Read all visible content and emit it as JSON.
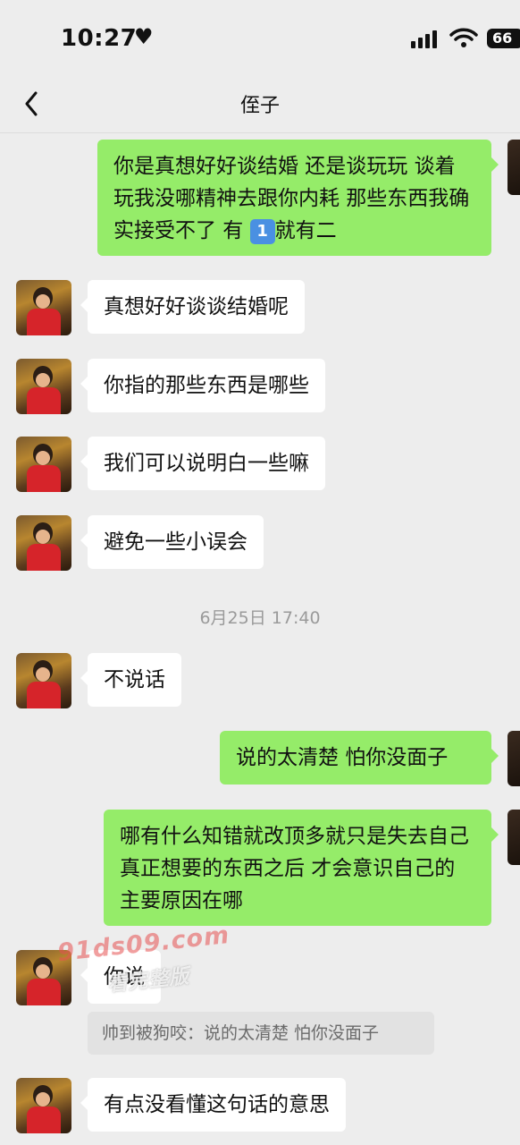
{
  "status": {
    "time": "10:27",
    "battery": "66"
  },
  "header": {
    "title": "侄子"
  },
  "messages": [
    {
      "side": "out",
      "text_a": "你是真想好好谈结婚 还是谈玩玩 谈着玩我没哪精神去跟你内耗 那些东西我确实接受不了 有",
      "emoji": "1",
      "text_b": "就有二"
    },
    {
      "side": "in",
      "text": "真想好好谈谈结婚呢"
    },
    {
      "side": "in",
      "text": "你指的那些东西是哪些"
    },
    {
      "side": "in",
      "text": "我们可以说明白一些嘛"
    },
    {
      "side": "in",
      "text": "避免一些小误会"
    },
    {
      "side": "in",
      "text": "不说话"
    },
    {
      "side": "out",
      "text": "说的太清楚 怕你没面子"
    },
    {
      "side": "out",
      "text": "哪有什么知错就改顶多就只是失去自己真正想要的东西之后 才会意识自己的主要原因在哪"
    },
    {
      "side": "in",
      "text": "你说"
    },
    {
      "side": "in",
      "text": "有点没看懂这句话的意思"
    }
  ],
  "timestamp": "6月25日 17:40",
  "quote": "帅到被狗咬：说的太清楚 怕你没面子",
  "watermark": {
    "line1": "91ds09.com",
    "line2": "看完整版"
  },
  "colors": {
    "outgoing": "#95ec69",
    "incoming": "#ffffff",
    "background": "#ededed"
  }
}
